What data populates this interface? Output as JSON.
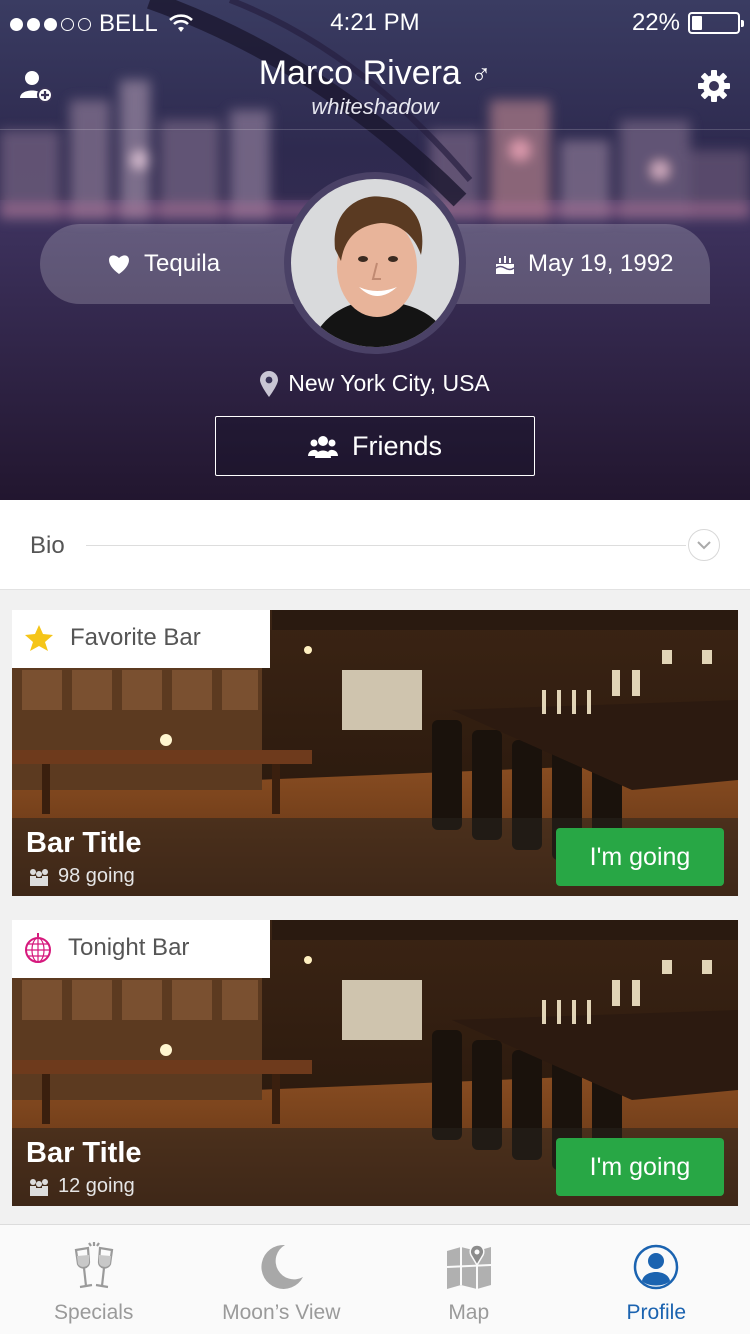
{
  "status_bar": {
    "carrier": "BELL",
    "time": "4:21 PM",
    "battery_percent": "22%",
    "battery_level": 0.22,
    "signal_bars_filled": 3,
    "signal_bars_total": 5
  },
  "profile": {
    "name": "Marco Rivera",
    "gender_symbol": "♂",
    "handle": "whiteshadow",
    "favorite_drink": "Tequila",
    "birthday": "May 19, 1992",
    "location": "New York City, USA",
    "friends_label": "Friends"
  },
  "bio": {
    "label": "Bio"
  },
  "cards": [
    {
      "tag": "Favorite Bar",
      "tag_icon": "star-icon",
      "title": "Bar Title",
      "count": "98 going",
      "button": "I'm going"
    },
    {
      "tag": "Tonight Bar",
      "tag_icon": "disco-ball-icon",
      "title": "Bar Title",
      "count": "12 going",
      "button": "I'm going"
    }
  ],
  "tabs": [
    {
      "label": "Specials",
      "icon": "wine-glasses-icon",
      "active": false
    },
    {
      "label": "Moon’s View",
      "icon": "moon-icon",
      "active": false
    },
    {
      "label": "Map",
      "icon": "map-icon",
      "active": false
    },
    {
      "label": "Profile",
      "icon": "profile-icon",
      "active": true
    }
  ],
  "colors": {
    "accent_green": "#28a745",
    "active_tab_blue": "#1b63b0",
    "star_yellow": "#f5c518",
    "disco_pink": "#d6197d"
  }
}
